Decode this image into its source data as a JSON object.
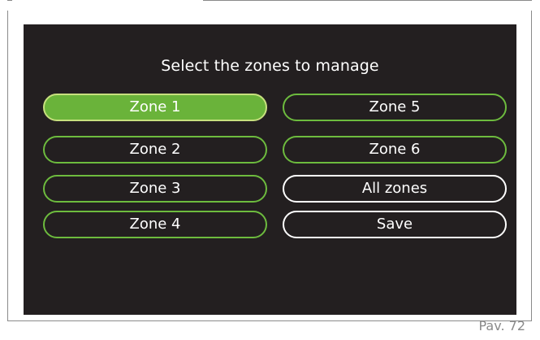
{
  "screen": {
    "title": "Select the zones to manage",
    "buttons": {
      "zone1": "Zone 1",
      "zone2": "Zone 2",
      "zone3": "Zone 3",
      "zone4": "Zone 4",
      "zone5": "Zone 5",
      "zone6": "Zone 6",
      "all_zones": "All zones",
      "save": "Save"
    },
    "selected": "zone1"
  },
  "page_label": "Pav. 72",
  "colors": {
    "screen_background": "#231f20",
    "zone_border": "#6dbb3e",
    "selected_fill": "#6ab33a",
    "selected_border": "#c7e07e",
    "action_border": "#ffffff",
    "text": "#ffffff"
  }
}
